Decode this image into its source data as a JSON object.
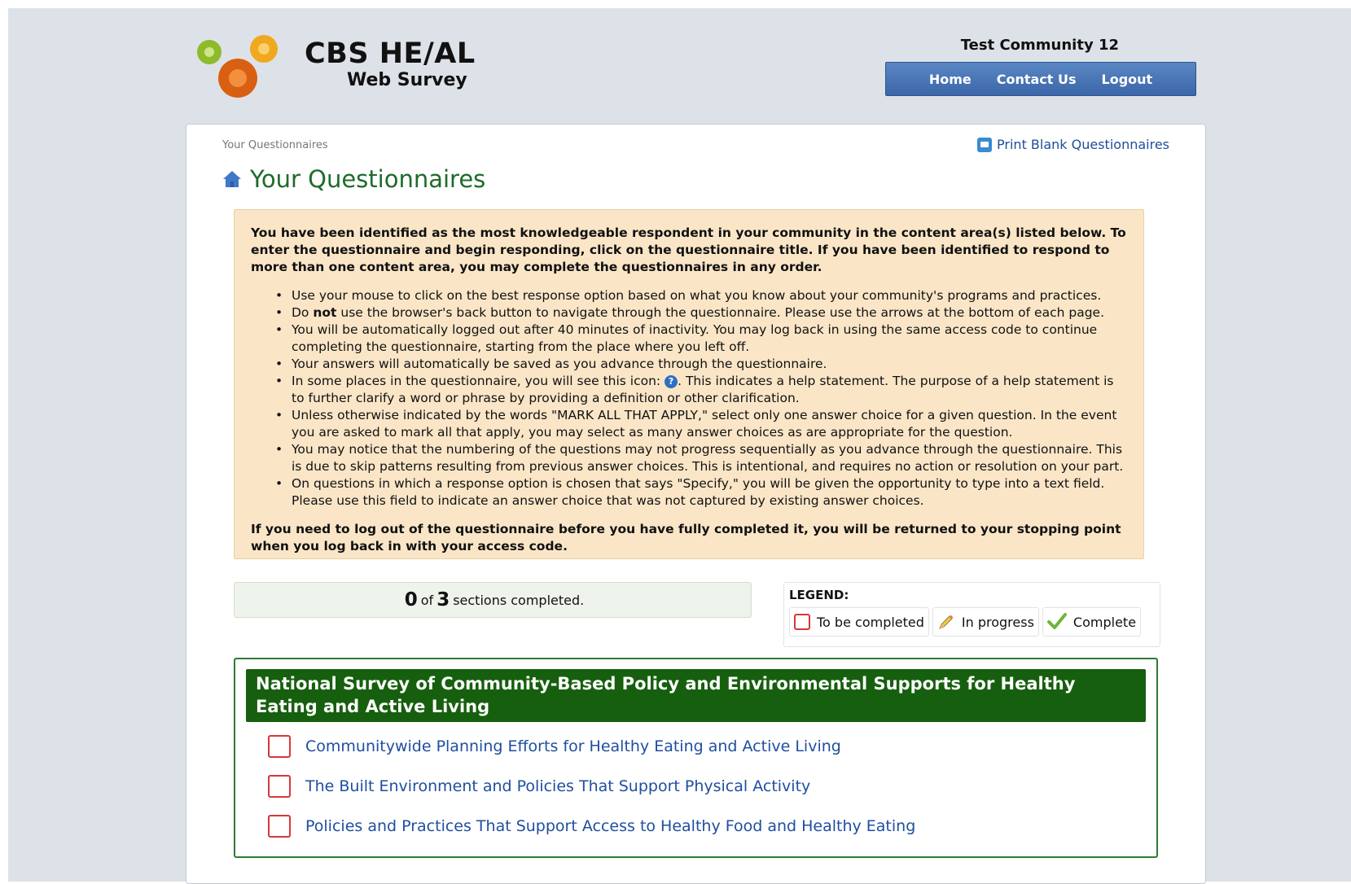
{
  "header": {
    "logo_title": "CBS HE/AL",
    "logo_subtitle": "Web Survey",
    "community": "Test Community 12",
    "nav": [
      "Home",
      "Contact Us",
      "Logout"
    ]
  },
  "breadcrumb": "Your Questionnaires",
  "print_link": "Print Blank Questionnaires",
  "page_title": "Your Questionnaires",
  "info": {
    "intro": "You have been identified as the most knowledgeable respondent in your community in the content area(s) listed below. To enter the questionnaire and begin responding, click on the questionnaire title. If you have been identified to respond to more than one content area, you may complete the questionnaires in any order.",
    "bullets": [
      "Use your mouse to click on the best response option based on what you know about your community's programs and practices.",
      "Do",
      "not",
      "use the browser's back button to navigate through the questionnaire. Please use the arrows at the bottom of each page.",
      "You will be automatically logged out after 40 minutes of inactivity. You may log back in using the same access code to continue completing the questionnaire, starting from the place where you left off.",
      "Your answers will automatically be saved as you advance through the questionnaire.",
      "In some places in the questionnaire, you will see this icon:",
      ". This indicates a help statement. The purpose of a help statement is to further clarify a word or phrase by providing a definition or other clarification.",
      "Unless otherwise indicated by the words \"MARK ALL THAT APPLY,\" select only one answer choice for a given question. In the event you are asked to mark all that apply, you may select as many answer choices as are appropriate for the question.",
      "You may notice that the numbering of the questions may not progress sequentially as you advance through the questionnaire. This is due to skip patterns resulting from previous answer choices. This is intentional, and requires no action or resolution on your part.",
      "On questions in which a response option is chosen that says \"Specify,\" you will be given the opportunity to type into a text field. Please use this field to indicate an answer choice that was not captured by existing answer choices."
    ],
    "help_glyph": "?",
    "outro": "If you need to log out of the questionnaire before you have fully completed it, you will be returned to your stopping point when you log back in with your access code."
  },
  "progress": {
    "completed": "0",
    "of": "of",
    "total": "3",
    "suffix": "sections completed."
  },
  "legend": {
    "title": "LEGEND:",
    "items": [
      "To be completed",
      "In progress",
      "Complete"
    ]
  },
  "survey": {
    "title": "National Survey of Community-Based Policy and Environmental Supports for Healthy Eating and Active Living",
    "sections": [
      "Communitywide Planning Efforts for Healthy Eating and Active Living",
      "The Built Environment and Policies That Support Physical Activity",
      "Policies and Practices That Support Access to Healthy Food and Healthy Eating"
    ]
  },
  "colors": {
    "accent_green": "#165f0e",
    "nav_blue": "#3b66a8",
    "info_bg": "#fae6c7",
    "todo_red": "#d7373a"
  }
}
